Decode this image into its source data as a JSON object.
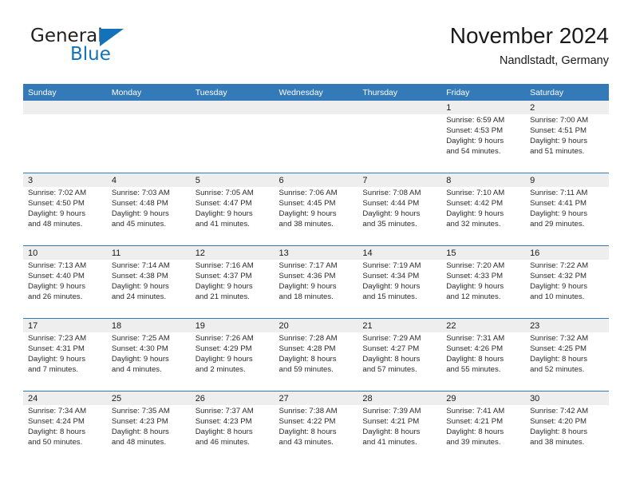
{
  "brand": {
    "name_part1": "General",
    "name_part2": "Blue",
    "logo_icon": "triangle-icon",
    "accent_color": "#1273ba"
  },
  "header": {
    "title": "November 2024",
    "subtitle": "Nandlstadt, Germany"
  },
  "theme": {
    "header_blue": "#3479b8",
    "daynum_band": "#eeeeee",
    "text": "#2b2b2b"
  },
  "calendar": {
    "day_names": [
      "Sunday",
      "Monday",
      "Tuesday",
      "Wednesday",
      "Thursday",
      "Friday",
      "Saturday"
    ],
    "labels": {
      "sunrise": "Sunrise:",
      "sunset": "Sunset:",
      "daylight": "Daylight:"
    },
    "weeks": [
      [
        {
          "day": "",
          "blank": true
        },
        {
          "day": "",
          "blank": true
        },
        {
          "day": "",
          "blank": true
        },
        {
          "day": "",
          "blank": true
        },
        {
          "day": "",
          "blank": true
        },
        {
          "day": "1",
          "sunrise": "Sunrise: 6:59 AM",
          "sunset": "Sunset: 4:53 PM",
          "daylight1": "Daylight: 9 hours",
          "daylight2": "and 54 minutes."
        },
        {
          "day": "2",
          "sunrise": "Sunrise: 7:00 AM",
          "sunset": "Sunset: 4:51 PM",
          "daylight1": "Daylight: 9 hours",
          "daylight2": "and 51 minutes."
        }
      ],
      [
        {
          "day": "3",
          "sunrise": "Sunrise: 7:02 AM",
          "sunset": "Sunset: 4:50 PM",
          "daylight1": "Daylight: 9 hours",
          "daylight2": "and 48 minutes."
        },
        {
          "day": "4",
          "sunrise": "Sunrise: 7:03 AM",
          "sunset": "Sunset: 4:48 PM",
          "daylight1": "Daylight: 9 hours",
          "daylight2": "and 45 minutes."
        },
        {
          "day": "5",
          "sunrise": "Sunrise: 7:05 AM",
          "sunset": "Sunset: 4:47 PM",
          "daylight1": "Daylight: 9 hours",
          "daylight2": "and 41 minutes."
        },
        {
          "day": "6",
          "sunrise": "Sunrise: 7:06 AM",
          "sunset": "Sunset: 4:45 PM",
          "daylight1": "Daylight: 9 hours",
          "daylight2": "and 38 minutes."
        },
        {
          "day": "7",
          "sunrise": "Sunrise: 7:08 AM",
          "sunset": "Sunset: 4:44 PM",
          "daylight1": "Daylight: 9 hours",
          "daylight2": "and 35 minutes."
        },
        {
          "day": "8",
          "sunrise": "Sunrise: 7:10 AM",
          "sunset": "Sunset: 4:42 PM",
          "daylight1": "Daylight: 9 hours",
          "daylight2": "and 32 minutes."
        },
        {
          "day": "9",
          "sunrise": "Sunrise: 7:11 AM",
          "sunset": "Sunset: 4:41 PM",
          "daylight1": "Daylight: 9 hours",
          "daylight2": "and 29 minutes."
        }
      ],
      [
        {
          "day": "10",
          "sunrise": "Sunrise: 7:13 AM",
          "sunset": "Sunset: 4:40 PM",
          "daylight1": "Daylight: 9 hours",
          "daylight2": "and 26 minutes."
        },
        {
          "day": "11",
          "sunrise": "Sunrise: 7:14 AM",
          "sunset": "Sunset: 4:38 PM",
          "daylight1": "Daylight: 9 hours",
          "daylight2": "and 24 minutes."
        },
        {
          "day": "12",
          "sunrise": "Sunrise: 7:16 AM",
          "sunset": "Sunset: 4:37 PM",
          "daylight1": "Daylight: 9 hours",
          "daylight2": "and 21 minutes."
        },
        {
          "day": "13",
          "sunrise": "Sunrise: 7:17 AM",
          "sunset": "Sunset: 4:36 PM",
          "daylight1": "Daylight: 9 hours",
          "daylight2": "and 18 minutes."
        },
        {
          "day": "14",
          "sunrise": "Sunrise: 7:19 AM",
          "sunset": "Sunset: 4:34 PM",
          "daylight1": "Daylight: 9 hours",
          "daylight2": "and 15 minutes."
        },
        {
          "day": "15",
          "sunrise": "Sunrise: 7:20 AM",
          "sunset": "Sunset: 4:33 PM",
          "daylight1": "Daylight: 9 hours",
          "daylight2": "and 12 minutes."
        },
        {
          "day": "16",
          "sunrise": "Sunrise: 7:22 AM",
          "sunset": "Sunset: 4:32 PM",
          "daylight1": "Daylight: 9 hours",
          "daylight2": "and 10 minutes."
        }
      ],
      [
        {
          "day": "17",
          "sunrise": "Sunrise: 7:23 AM",
          "sunset": "Sunset: 4:31 PM",
          "daylight1": "Daylight: 9 hours",
          "daylight2": "and 7 minutes."
        },
        {
          "day": "18",
          "sunrise": "Sunrise: 7:25 AM",
          "sunset": "Sunset: 4:30 PM",
          "daylight1": "Daylight: 9 hours",
          "daylight2": "and 4 minutes."
        },
        {
          "day": "19",
          "sunrise": "Sunrise: 7:26 AM",
          "sunset": "Sunset: 4:29 PM",
          "daylight1": "Daylight: 9 hours",
          "daylight2": "and 2 minutes."
        },
        {
          "day": "20",
          "sunrise": "Sunrise: 7:28 AM",
          "sunset": "Sunset: 4:28 PM",
          "daylight1": "Daylight: 8 hours",
          "daylight2": "and 59 minutes."
        },
        {
          "day": "21",
          "sunrise": "Sunrise: 7:29 AM",
          "sunset": "Sunset: 4:27 PM",
          "daylight1": "Daylight: 8 hours",
          "daylight2": "and 57 minutes."
        },
        {
          "day": "22",
          "sunrise": "Sunrise: 7:31 AM",
          "sunset": "Sunset: 4:26 PM",
          "daylight1": "Daylight: 8 hours",
          "daylight2": "and 55 minutes."
        },
        {
          "day": "23",
          "sunrise": "Sunrise: 7:32 AM",
          "sunset": "Sunset: 4:25 PM",
          "daylight1": "Daylight: 8 hours",
          "daylight2": "and 52 minutes."
        }
      ],
      [
        {
          "day": "24",
          "sunrise": "Sunrise: 7:34 AM",
          "sunset": "Sunset: 4:24 PM",
          "daylight1": "Daylight: 8 hours",
          "daylight2": "and 50 minutes."
        },
        {
          "day": "25",
          "sunrise": "Sunrise: 7:35 AM",
          "sunset": "Sunset: 4:23 PM",
          "daylight1": "Daylight: 8 hours",
          "daylight2": "and 48 minutes."
        },
        {
          "day": "26",
          "sunrise": "Sunrise: 7:37 AM",
          "sunset": "Sunset: 4:23 PM",
          "daylight1": "Daylight: 8 hours",
          "daylight2": "and 46 minutes."
        },
        {
          "day": "27",
          "sunrise": "Sunrise: 7:38 AM",
          "sunset": "Sunset: 4:22 PM",
          "daylight1": "Daylight: 8 hours",
          "daylight2": "and 43 minutes."
        },
        {
          "day": "28",
          "sunrise": "Sunrise: 7:39 AM",
          "sunset": "Sunset: 4:21 PM",
          "daylight1": "Daylight: 8 hours",
          "daylight2": "and 41 minutes."
        },
        {
          "day": "29",
          "sunrise": "Sunrise: 7:41 AM",
          "sunset": "Sunset: 4:21 PM",
          "daylight1": "Daylight: 8 hours",
          "daylight2": "and 39 minutes."
        },
        {
          "day": "30",
          "sunrise": "Sunrise: 7:42 AM",
          "sunset": "Sunset: 4:20 PM",
          "daylight1": "Daylight: 8 hours",
          "daylight2": "and 38 minutes."
        }
      ]
    ]
  }
}
